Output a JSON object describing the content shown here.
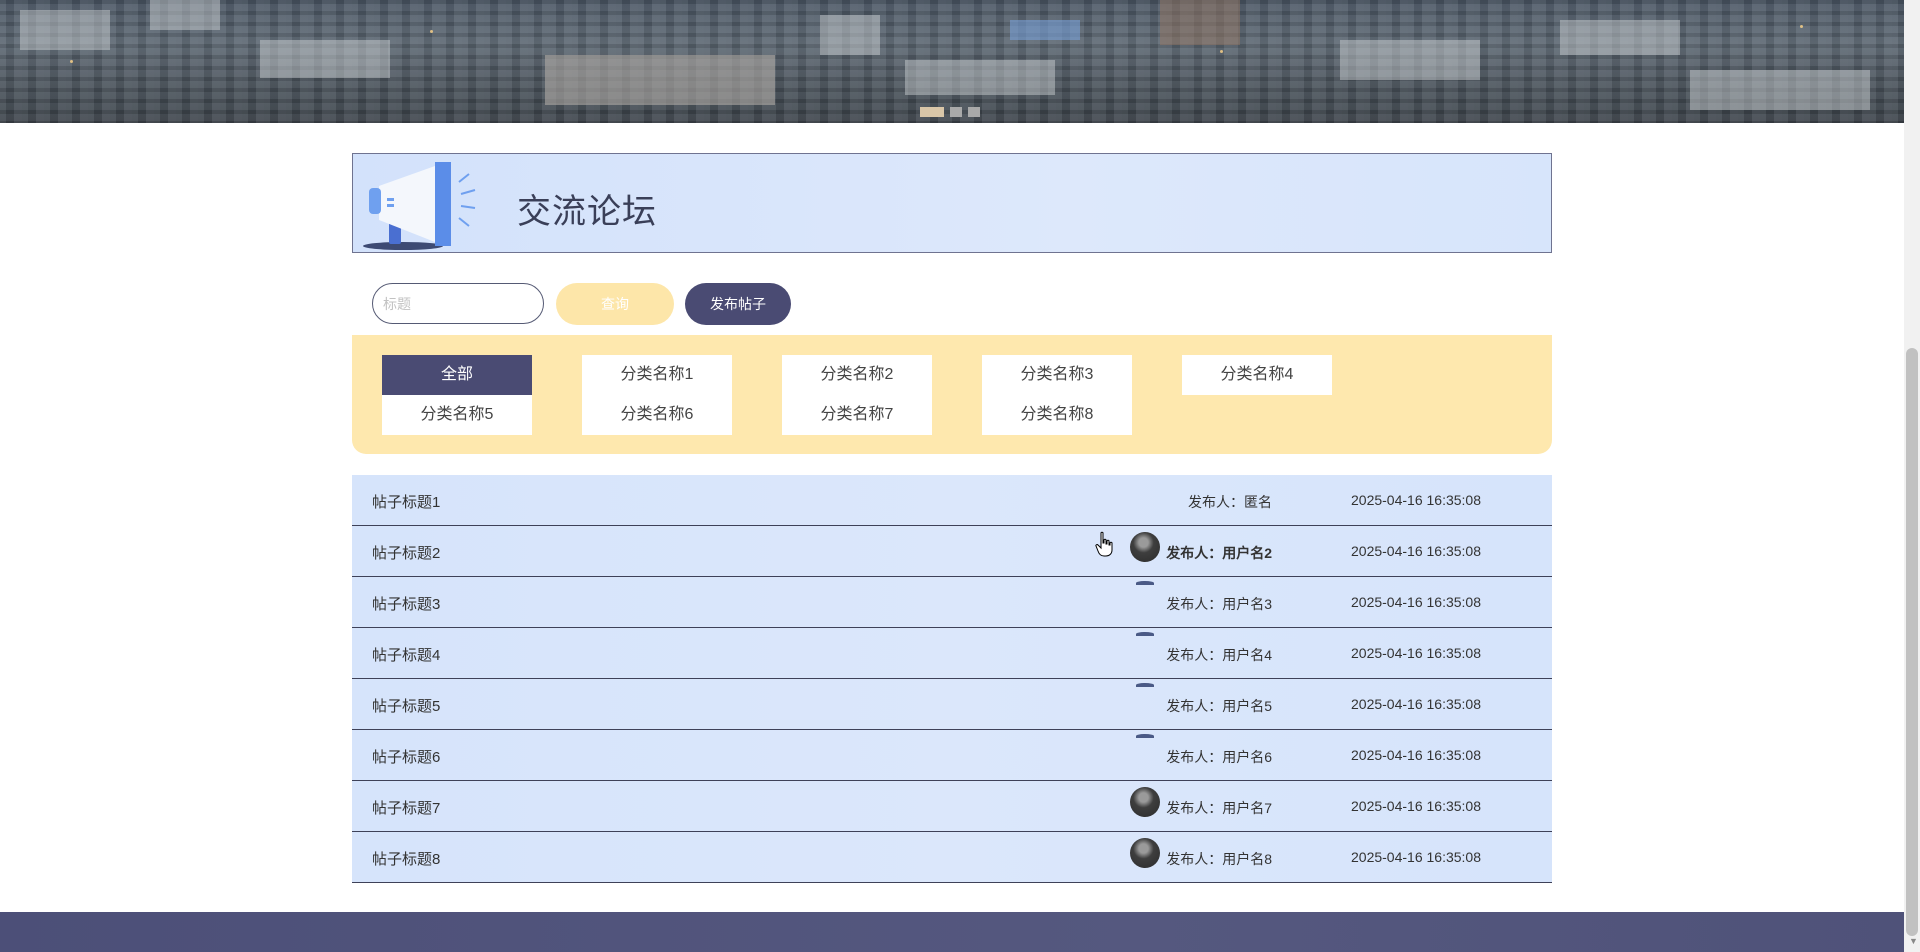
{
  "banner": {
    "carousel_dots": [
      {
        "active": true
      },
      {
        "active": false
      },
      {
        "active": false
      }
    ]
  },
  "forum": {
    "title": "交流论坛",
    "header_icon": "megaphone-icon"
  },
  "search": {
    "placeholder": "标题",
    "value": "",
    "query_label": "查询",
    "post_label": "发布帖子"
  },
  "categories": [
    {
      "label": "全部",
      "active": true
    },
    {
      "label": "分类名称1",
      "active": false
    },
    {
      "label": "分类名称2",
      "active": false
    },
    {
      "label": "分类名称3",
      "active": false
    },
    {
      "label": "分类名称4",
      "active": false
    },
    {
      "label": "分类名称5",
      "active": false
    },
    {
      "label": "分类名称6",
      "active": false
    },
    {
      "label": "分类名称7",
      "active": false
    },
    {
      "label": "分类名称8",
      "active": false
    }
  ],
  "posts": [
    {
      "title": "帖子标题1",
      "author": "发布人：匿名",
      "time": "2025-04-16 16:35:08",
      "avatar": "none"
    },
    {
      "title": "帖子标题2",
      "author": "发布人：用户名2",
      "time": "2025-04-16 16:35:08",
      "avatar": "photo"
    },
    {
      "title": "帖子标题3",
      "author": "发布人：用户名3",
      "time": "2025-04-16 16:35:08",
      "avatar": "faint"
    },
    {
      "title": "帖子标题4",
      "author": "发布人：用户名4",
      "time": "2025-04-16 16:35:08",
      "avatar": "faint"
    },
    {
      "title": "帖子标题5",
      "author": "发布人：用户名5",
      "time": "2025-04-16 16:35:08",
      "avatar": "faint"
    },
    {
      "title": "帖子标题6",
      "author": "发布人：用户名6",
      "time": "2025-04-16 16:35:08",
      "avatar": "faint"
    },
    {
      "title": "帖子标题7",
      "author": "发布人：用户名7",
      "time": "2025-04-16 16:35:08",
      "avatar": "photo"
    },
    {
      "title": "帖子标题8",
      "author": "发布人：用户名8",
      "time": "2025-04-16 16:35:08",
      "avatar": "photo"
    }
  ],
  "colors": {
    "primary": "#4a4b73",
    "accent_yellow": "#fee8ae",
    "list_bg": "#d6e4fb"
  }
}
